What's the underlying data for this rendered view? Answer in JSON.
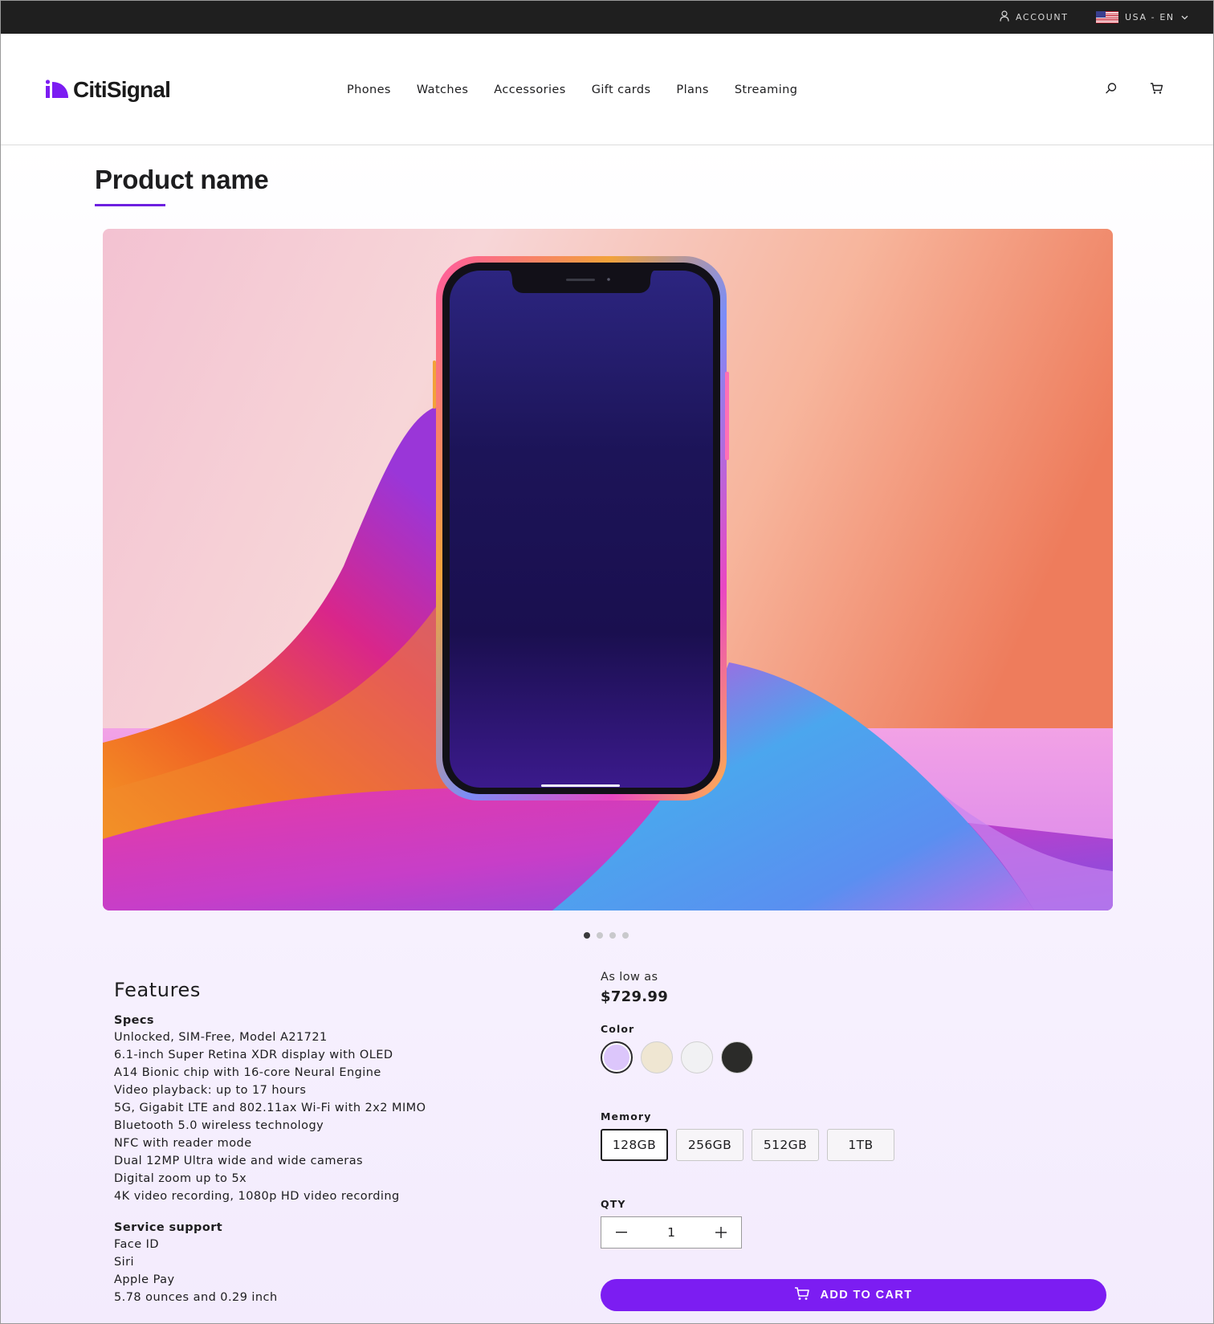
{
  "topbar": {
    "account_label": "ACCOUNT",
    "locale_label": "USA - EN"
  },
  "header": {
    "logo_text": "CitiSignal",
    "nav": [
      "Phones",
      "Watches",
      "Accessories",
      "Gift cards",
      "Plans",
      "Streaming"
    ],
    "icons": [
      "search-icon",
      "cart-icon"
    ]
  },
  "product": {
    "title": "Product name",
    "carousel": {
      "total": 4,
      "active": 1
    }
  },
  "features": {
    "heading": "Features",
    "specs_heading": "Specs",
    "specs": [
      "Unlocked, SIM-Free, Model A21721",
      "6.1-inch Super Retina XDR display with OLED",
      "A14 Bionic chip with 16-core Neural Engine",
      "Video playback: up to 17 hours",
      "5G, Gigabit LTE and 802.11ax Wi-Fi with 2x2 MIMO",
      "Bluetooth 5.0 wireless technology",
      "NFC with reader mode",
      "Dual 12MP Ultra wide and wide cameras",
      "Digital zoom up to 5x",
      "4K video recording, 1080p HD video recording"
    ],
    "service_heading": "Service support",
    "service": [
      "Face ID",
      "Siri",
      "Apple Pay",
      "5.78 ounces and 0.29 inch"
    ]
  },
  "purchase": {
    "price_prefix": "As low as",
    "price": "$729.99",
    "color_label": "Color",
    "colors": [
      {
        "name": "lavender",
        "hex": "#dcc6fb",
        "selected": true
      },
      {
        "name": "cream",
        "hex": "#efe6d2",
        "selected": false
      },
      {
        "name": "white",
        "hex": "#f1f1f3",
        "selected": false
      },
      {
        "name": "black",
        "hex": "#2b2b29",
        "selected": false
      }
    ],
    "memory_label": "Memory",
    "memory_options": [
      {
        "label": "128GB",
        "selected": true
      },
      {
        "label": "256GB",
        "selected": false
      },
      {
        "label": "512GB",
        "selected": false
      },
      {
        "label": "1TB",
        "selected": false
      }
    ],
    "qty_label": "QTY",
    "qty_value": "1",
    "add_to_cart": "ADD TO CART"
  },
  "colors": {
    "accent": "#7c1df2",
    "topbar": "#1f1f1f",
    "underline": "#6d1fe0"
  }
}
